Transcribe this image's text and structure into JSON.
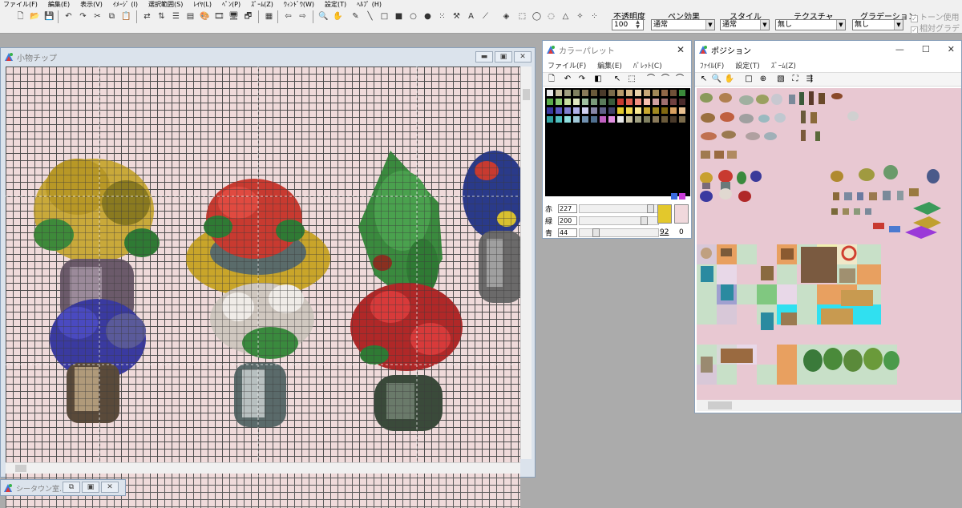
{
  "menu": {
    "items": [
      "ファイル(F)",
      "編集(E)",
      "表示(V)",
      "ｲﾒｰｼﾞ (I)",
      "選択範囲(S)",
      "ﾚｲﾔ(L)",
      "ﾍﾟﾝ(P)",
      "ｽﾞｰﾑ(Z)",
      "ｳｨﾝﾄﾞｳ(W)",
      "設定(T)",
      "ﾍﾙﾌﾟ (H)"
    ]
  },
  "options": {
    "opacity_label": "不透明度",
    "opacity_value": "100",
    "pen_effect_label": "ペン効果",
    "pen_effect_value": "通常",
    "style_label": "スタイル",
    "style_value": "通常",
    "texture_label": "テクスチャ",
    "texture_value": "無し",
    "gradation_label": "グラデーション",
    "gradation_value": "無し",
    "tone_label": "トーン使用",
    "relative_gradation_label": "相対グラデ"
  },
  "canvas_window": {
    "title": "小物チップ",
    "minimize": "▬",
    "maximize": "▣",
    "close": "✕"
  },
  "minimized_window": {
    "title": "シータウン室...",
    "restore": "⧉",
    "maximize": "▣",
    "close": "✕"
  },
  "palette_window": {
    "title": "カラーパレット",
    "menu": [
      "ファイル(F)",
      "編集(E)",
      "ﾊﾟﾚｯﾄ(C)"
    ],
    "close": "✕",
    "red_label": "赤",
    "red_value": "227",
    "green_label": "緑",
    "green_value": "200",
    "blue_label": "青",
    "blue_value": "44",
    "index_value": "92",
    "alpha_value": "0",
    "current_color": "#e3c82c"
  },
  "position_window": {
    "title": "ポジション",
    "menu": [
      "ﾌｧｲﾙ(F)",
      "設定(T)",
      "ｽﾞｰﾑ(Z)"
    ],
    "minimize": "—",
    "maximize": "☐",
    "close": "✕"
  },
  "colors": {
    "canvas_bg": "#efdada",
    "grid": "#5b5b5b",
    "position_bg": "#e8c8d2"
  }
}
